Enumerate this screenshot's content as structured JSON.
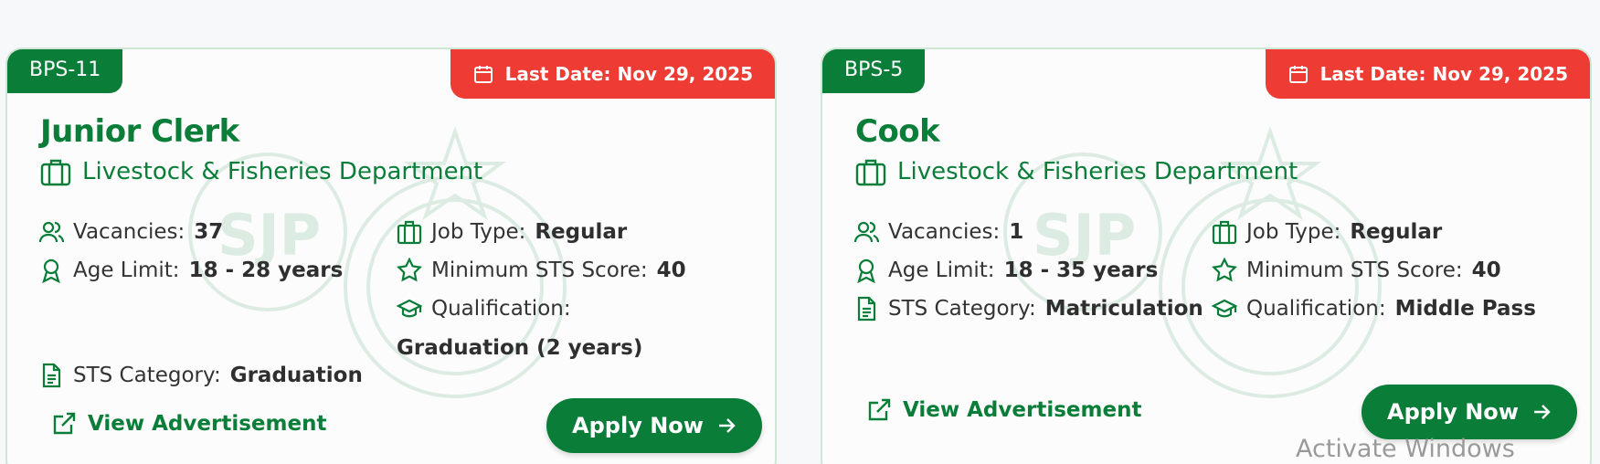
{
  "cards": [
    {
      "grade": "BPS-11",
      "last_date": "Last Date: Nov 29, 2025",
      "title": "Junior Clerk",
      "department": "Livestock & Fisheries Department",
      "vacancies_label": "Vacancies:",
      "vacancies": "37",
      "age_label": "Age Limit:",
      "age": "18 - 28 years",
      "category_label": "STS Category:",
      "category": "Graduation",
      "job_type_label": "Job Type:",
      "job_type": "Regular",
      "min_score_label": "Minimum STS Score:",
      "min_score": "40",
      "qualification_label": "Qualification:",
      "qualification": "Graduation (2 years)",
      "view_label": "View Advertisement",
      "apply_label": "Apply Now"
    },
    {
      "grade": "BPS-5",
      "last_date": "Last Date: Nov 29, 2025",
      "title": "Cook",
      "department": "Livestock & Fisheries Department",
      "vacancies_label": "Vacancies:",
      "vacancies": "1",
      "age_label": "Age Limit:",
      "age": "18 - 35 years",
      "category_label": "STS Category:",
      "category": "Matriculation",
      "job_type_label": "Job Type:",
      "job_type": "Regular",
      "min_score_label": "Minimum STS Score:",
      "min_score": "40",
      "qualification_label": "Qualification:",
      "qualification": "Middle Pass",
      "view_label": "View Advertisement",
      "apply_label": "Apply Now"
    }
  ],
  "watermark_text": "SJP",
  "os_overlay": "Activate Windows",
  "colors": {
    "brand_green": "#0a7d39",
    "deadline_red": "#ee3b34",
    "card_border": "#cfe6d5"
  },
  "icons": [
    "calendar-icon",
    "briefcase-icon",
    "users-icon",
    "award-icon",
    "document-icon",
    "star-icon",
    "graduation-cap-icon",
    "external-link-icon",
    "arrow-right-icon"
  ]
}
